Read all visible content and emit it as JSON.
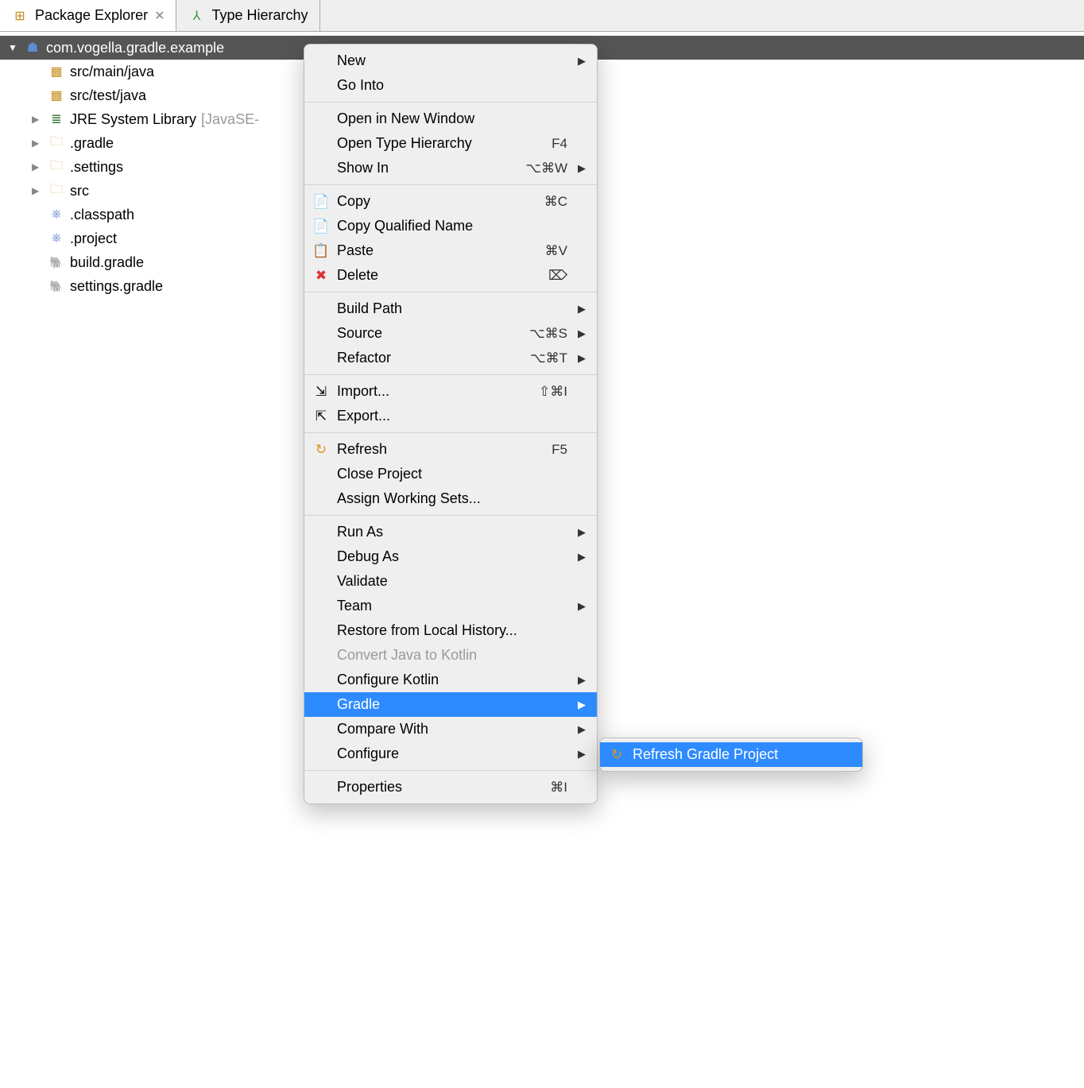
{
  "tabs": {
    "package_explorer": "Package Explorer",
    "type_hierarchy": "Type Hierarchy"
  },
  "tree": {
    "project": "com.vogella.gradle.example",
    "items": [
      {
        "label": "src/main/java",
        "icon": "package"
      },
      {
        "label": "src/test/java",
        "icon": "package"
      },
      {
        "label": "JRE System Library",
        "suffix": "[JavaSE-",
        "icon": "library",
        "expandable": true
      },
      {
        "label": ".gradle",
        "icon": "folder",
        "expandable": true
      },
      {
        "label": ".settings",
        "icon": "folder",
        "expandable": true
      },
      {
        "label": "src",
        "icon": "folder",
        "expandable": true
      },
      {
        "label": ".classpath",
        "icon": "xmlfile"
      },
      {
        "label": ".project",
        "icon": "xmlfile"
      },
      {
        "label": "build.gradle",
        "icon": "gradle"
      },
      {
        "label": "settings.gradle",
        "icon": "gradle"
      }
    ]
  },
  "menu": {
    "groups": [
      [
        {
          "label": "New",
          "arrow": true
        },
        {
          "label": "Go Into"
        }
      ],
      [
        {
          "label": "Open in New Window"
        },
        {
          "label": "Open Type Hierarchy",
          "shortcut": "F4"
        },
        {
          "label": "Show In",
          "shortcut": "⌥⌘W",
          "arrow": true
        }
      ],
      [
        {
          "label": "Copy",
          "icon": "copy",
          "shortcut": "⌘C"
        },
        {
          "label": "Copy Qualified Name",
          "icon": "copy"
        },
        {
          "label": "Paste",
          "icon": "paste",
          "shortcut": "⌘V"
        },
        {
          "label": "Delete",
          "icon": "delete",
          "shortcut": "⌦"
        }
      ],
      [
        {
          "label": "Build Path",
          "arrow": true
        },
        {
          "label": "Source",
          "shortcut": "⌥⌘S",
          "arrow": true
        },
        {
          "label": "Refactor",
          "shortcut": "⌥⌘T",
          "arrow": true
        }
      ],
      [
        {
          "label": "Import...",
          "icon": "import",
          "shortcut": "⇧⌘I"
        },
        {
          "label": "Export...",
          "icon": "export"
        }
      ],
      [
        {
          "label": "Refresh",
          "icon": "refresh",
          "shortcut": "F5"
        },
        {
          "label": "Close Project"
        },
        {
          "label": "Assign Working Sets..."
        }
      ],
      [
        {
          "label": "Run As",
          "arrow": true
        },
        {
          "label": "Debug As",
          "arrow": true
        },
        {
          "label": "Validate"
        },
        {
          "label": "Team",
          "arrow": true
        },
        {
          "label": "Restore from Local History..."
        },
        {
          "label": "Convert Java to Kotlin",
          "disabled": true
        },
        {
          "label": "Configure Kotlin",
          "arrow": true
        },
        {
          "label": "Gradle",
          "arrow": true,
          "highlight": true
        },
        {
          "label": "Compare With",
          "arrow": true
        },
        {
          "label": "Configure",
          "arrow": true
        }
      ],
      [
        {
          "label": "Properties",
          "shortcut": "⌘I"
        }
      ]
    ]
  },
  "submenu": {
    "items": [
      {
        "label": "Refresh Gradle Project",
        "icon": "refresh",
        "highlight": true
      }
    ]
  }
}
